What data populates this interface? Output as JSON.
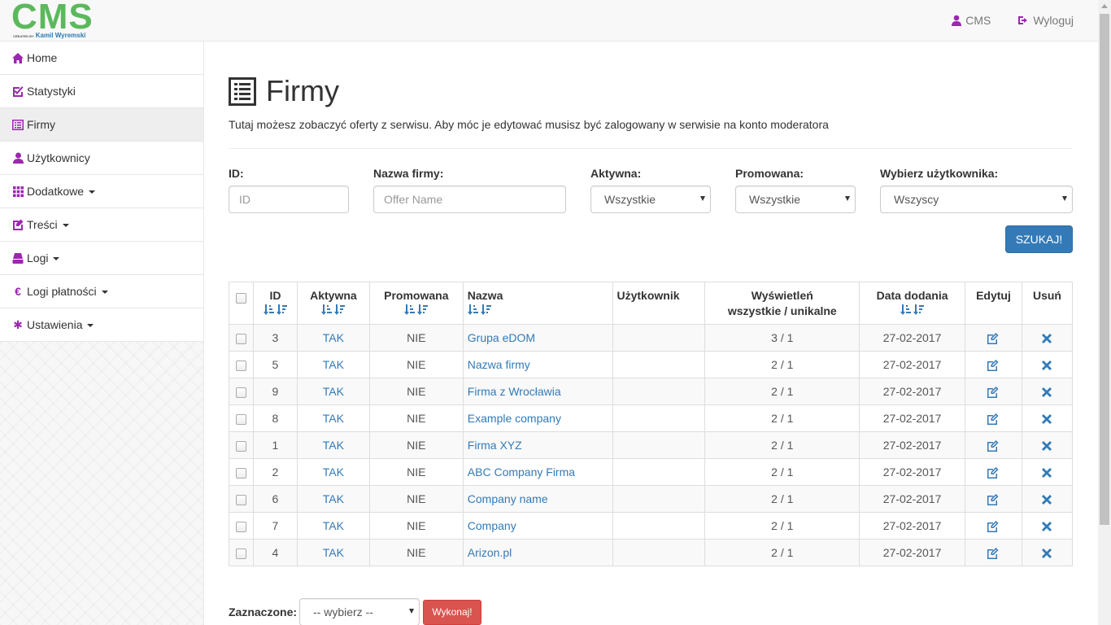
{
  "navbar": {
    "logo_text": "CMS",
    "logo_small": "CREATED BY",
    "logo_author": "Kamil Wyremski",
    "user_label": "CMS",
    "logout_label": "Wyloguj"
  },
  "sidebar": {
    "items": [
      {
        "label": "Home",
        "icon": "home-icon"
      },
      {
        "label": "Statystyki",
        "icon": "check-square-icon"
      },
      {
        "label": "Firmy",
        "icon": "list-alt-icon"
      },
      {
        "label": "Użytkownicy",
        "icon": "user-icon"
      },
      {
        "label": "Dodatkowe",
        "icon": "grid-icon"
      },
      {
        "label": "Treści",
        "icon": "edit-icon"
      },
      {
        "label": "Logi",
        "icon": "hdd-icon"
      },
      {
        "label": "Logi płatności",
        "icon": "euro-icon"
      },
      {
        "label": "Ustawienia",
        "icon": "asterisk-icon"
      }
    ]
  },
  "page": {
    "title": "Firmy",
    "subtitle": "Tutaj możesz zobaczyć oferty z serwisu. Aby móc je edytować musisz być zalogowany w serwisie na konto moderatora"
  },
  "filters": {
    "id_label": "ID:",
    "id_placeholder": "ID",
    "name_label": "Nazwa firmy:",
    "name_placeholder": "Offer Name",
    "active_label": "Aktywna:",
    "active_value": "Wszystkie",
    "promoted_label": "Promowana:",
    "promoted_value": "Wszystkie",
    "user_label": "Wybierz użytkownika:",
    "user_value": "Wszyscy",
    "search_button": "SZUKAJ!"
  },
  "table": {
    "headers": {
      "id": "ID",
      "active": "Aktywna",
      "promoted": "Promowana",
      "name": "Nazwa",
      "user": "Użytkownik",
      "views_line1": "Wyświetleń",
      "views_line2": "wszystkie / unikalne",
      "date": "Data dodania",
      "edit": "Edytuj",
      "delete": "Usuń"
    },
    "rows": [
      {
        "id": "3",
        "active": "TAK",
        "promoted": "NIE",
        "name": "Grupa eDOM",
        "user": "",
        "views": "3 / 1",
        "date": "27-02-2017"
      },
      {
        "id": "5",
        "active": "TAK",
        "promoted": "NIE",
        "name": "Nazwa firmy",
        "user": "",
        "views": "2 / 1",
        "date": "27-02-2017"
      },
      {
        "id": "9",
        "active": "TAK",
        "promoted": "NIE",
        "name": "Firma z Wrocławia",
        "user": "",
        "views": "2 / 1",
        "date": "27-02-2017"
      },
      {
        "id": "8",
        "active": "TAK",
        "promoted": "NIE",
        "name": "Example company",
        "user": "",
        "views": "2 / 1",
        "date": "27-02-2017"
      },
      {
        "id": "1",
        "active": "TAK",
        "promoted": "NIE",
        "name": "Firma XYZ",
        "user": "",
        "views": "2 / 1",
        "date": "27-02-2017"
      },
      {
        "id": "2",
        "active": "TAK",
        "promoted": "NIE",
        "name": "ABC Company Firma",
        "user": "",
        "views": "2 / 1",
        "date": "27-02-2017"
      },
      {
        "id": "6",
        "active": "TAK",
        "promoted": "NIE",
        "name": "Company name",
        "user": "",
        "views": "2 / 1",
        "date": "27-02-2017"
      },
      {
        "id": "7",
        "active": "TAK",
        "promoted": "NIE",
        "name": "Company",
        "user": "",
        "views": "2 / 1",
        "date": "27-02-2017"
      },
      {
        "id": "4",
        "active": "TAK",
        "promoted": "NIE",
        "name": "Arizon.pl",
        "user": "",
        "views": "2 / 1",
        "date": "27-02-2017"
      }
    ]
  },
  "bulk": {
    "label": "Zaznaczone:",
    "select_value": "-- wybierz --",
    "execute_button": "Wykonaj!"
  },
  "colors": {
    "accent": "#9c27b0",
    "link": "#337ab7",
    "logo_green": "#5cb85c",
    "danger": "#d9534f"
  }
}
